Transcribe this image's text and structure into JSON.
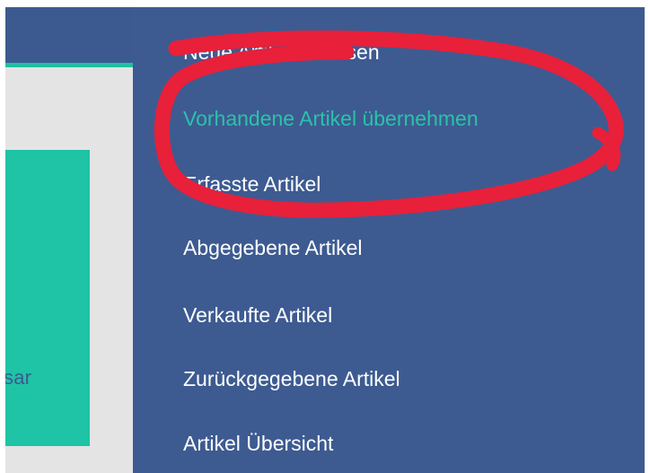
{
  "left_panel": {
    "card_text": "sar"
  },
  "menu": {
    "items": [
      {
        "label": "Neue Artikel erfassen"
      },
      {
        "label": "Vorhandene Artikel übernehmen"
      },
      {
        "label": "Erfasste Artikel"
      },
      {
        "label": "Abgegebene Artikel"
      },
      {
        "label": "Verkaufte Artikel"
      },
      {
        "label": "Zurückgegebene Artikel"
      },
      {
        "label": "Artikel Übersicht"
      }
    ]
  },
  "colors": {
    "menu_background": "#3d5b91",
    "active_item": "#2bc2a8",
    "accent": "#20c0a3",
    "annotation": "#e8203a"
  }
}
